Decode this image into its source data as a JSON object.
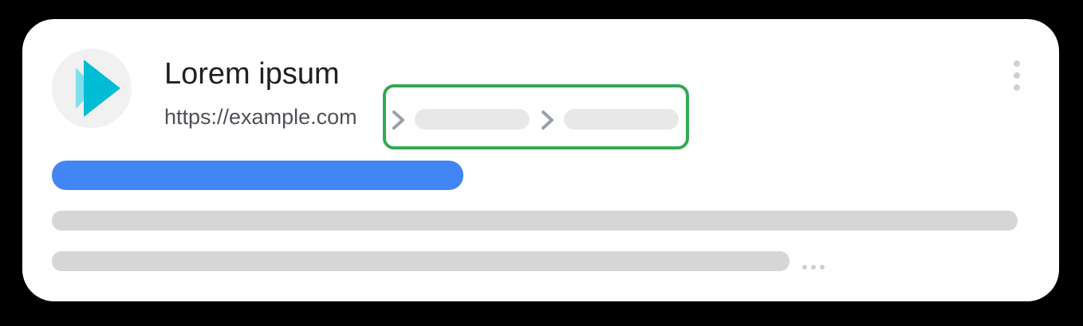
{
  "result": {
    "title": "Lorem ipsum",
    "url": "https://example.com",
    "favicon": "play-icon",
    "breadcrumb_separator_icon": "chevron-right-icon",
    "menu_icon": "more-vert-icon",
    "truncation_icon": "ellipsis-icon"
  },
  "colors": {
    "background": "#000000",
    "card": "#ffffff",
    "link_bar": "#4285f4",
    "placeholder": "#d6d6d6",
    "breadcrumb_placeholder": "#e8e8e8",
    "highlight": "#34a853",
    "favicon_dark": "#00bcd4",
    "favicon_light": "#80deea"
  }
}
